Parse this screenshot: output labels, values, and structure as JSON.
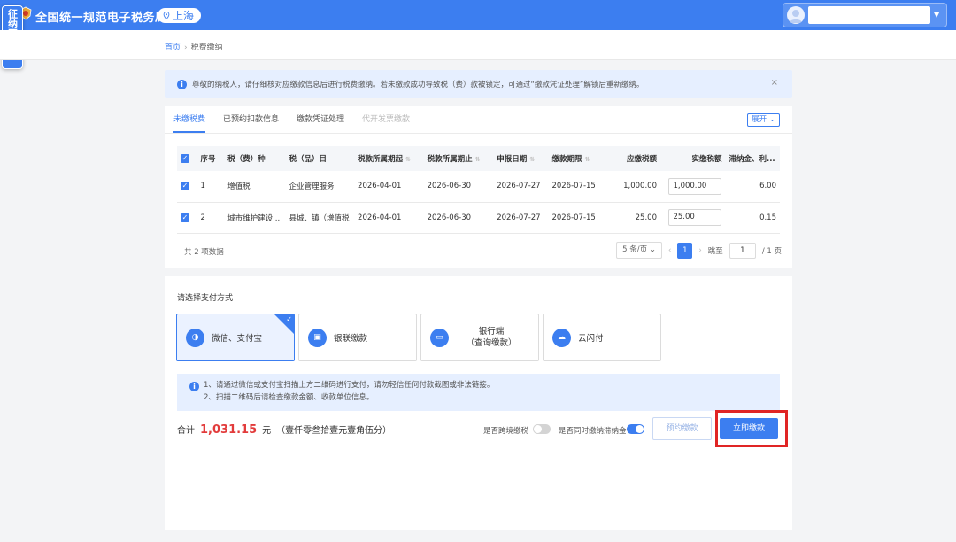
{
  "side_tab": "征纳互动",
  "header": {
    "site_title": "全国统一规范电子税务局",
    "city": "上海",
    "username": ""
  },
  "breadcrumb": {
    "home": "首页",
    "separator": "›",
    "current": "税费缴纳"
  },
  "notice": {
    "text": "尊敬的纳税人，请仔细核对应缴款信息后进行税费缴纳。若未缴款成功导致税（费）款被锁定，可通过“缴款凭证处理”解锁后重新缴纳。",
    "close": "×"
  },
  "tabs": [
    "未缴税费",
    "已预约扣款信息",
    "缴款凭证处理",
    "代开发票缴款"
  ],
  "expand_label": "展开",
  "table": {
    "headers": [
      "序号",
      "税（费）种",
      "税（品）目",
      "税款所属期起",
      "税款所属期止",
      "申报日期",
      "缴款期限",
      "应缴税额",
      "实缴税额",
      "滞纳金、利..."
    ],
    "rows": [
      {
        "no": "1",
        "tax": "增值税",
        "item": "企业管理服务",
        "start": "2026-04-01",
        "end": "2026-06-30",
        "declare": "2026-07-27",
        "deadline": "2026-07-15",
        "due": "1,000.00",
        "paid": "1,000.00",
        "late": "6.00"
      },
      {
        "no": "2",
        "tax": "城市维护建设...",
        "item": "县城、镇（增值税",
        "start": "2026-04-01",
        "end": "2026-06-30",
        "declare": "2026-07-27",
        "deadline": "2026-07-15",
        "due": "25.00",
        "paid": "25.00",
        "late": "0.15"
      }
    ]
  },
  "pagination": {
    "total": "共 2 项数据",
    "page_size": "5 条/页",
    "current_page": "1",
    "jump_label": "跳至",
    "jump_value": "1",
    "pages": "/ 1 页"
  },
  "payment": {
    "title": "请选择支付方式",
    "methods": [
      {
        "label": "微信、支付宝",
        "icon": "wechat-alipay-icon"
      },
      {
        "label": "银联缴款",
        "icon": "unionpay-icon"
      },
      {
        "label_line1": "银行端",
        "label_line2": "（查询缴款）",
        "icon": "bank-card-icon"
      },
      {
        "label": "云闪付",
        "icon": "cloud-pay-icon"
      }
    ],
    "tips": [
      "1、请通过微信或支付宝扫描上方二维码进行支付，请勿轻信任何付款截图或非法链接。",
      "2、扫描二维码后请检查缴款金额、收款单位信息。"
    ]
  },
  "summary": {
    "total_label": "合计",
    "amount": "1,031.15",
    "unit": "元",
    "amount_words": "（壹仟零叁拾壹元壹角伍分）",
    "cross_region_label": "是否跨境缴税",
    "cross_region_on": false,
    "late_fee_label": "是否同时缴纳滞纳金",
    "late_fee_on": true,
    "reserve_button": "预约缴款",
    "pay_button": "立即缴款"
  },
  "colors": {
    "primary": "#3c7ef0",
    "amount": "#e23b3b",
    "highlight": "#e02525"
  }
}
